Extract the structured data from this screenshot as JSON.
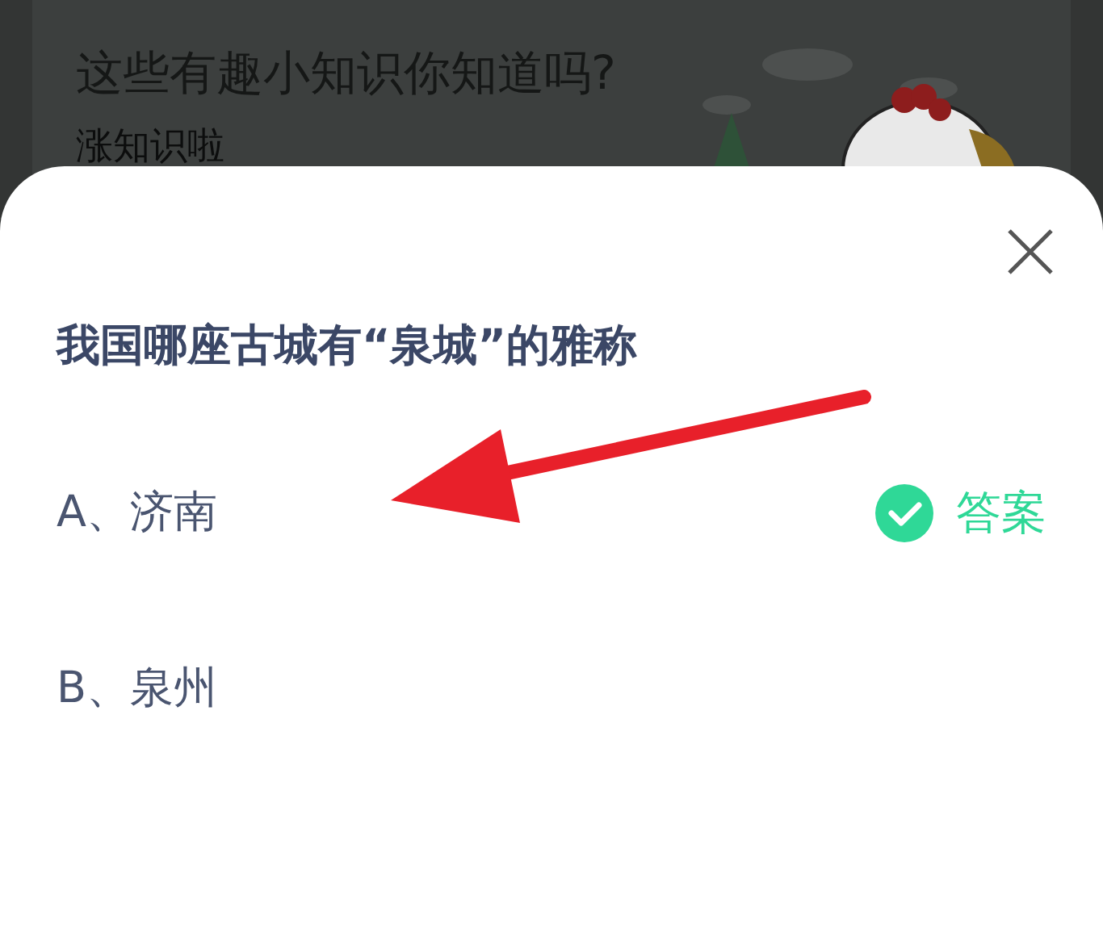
{
  "background_card": {
    "title": "这些有趣小知识你知道吗?",
    "subtitle": "涨知识啦"
  },
  "dialog": {
    "question": "我国哪座古城有“泉城”的雅称",
    "options": [
      {
        "text": "A、济南",
        "is_answer": true,
        "answer_label": "答案"
      },
      {
        "text": "B、泉州",
        "is_answer": false
      }
    ]
  }
}
